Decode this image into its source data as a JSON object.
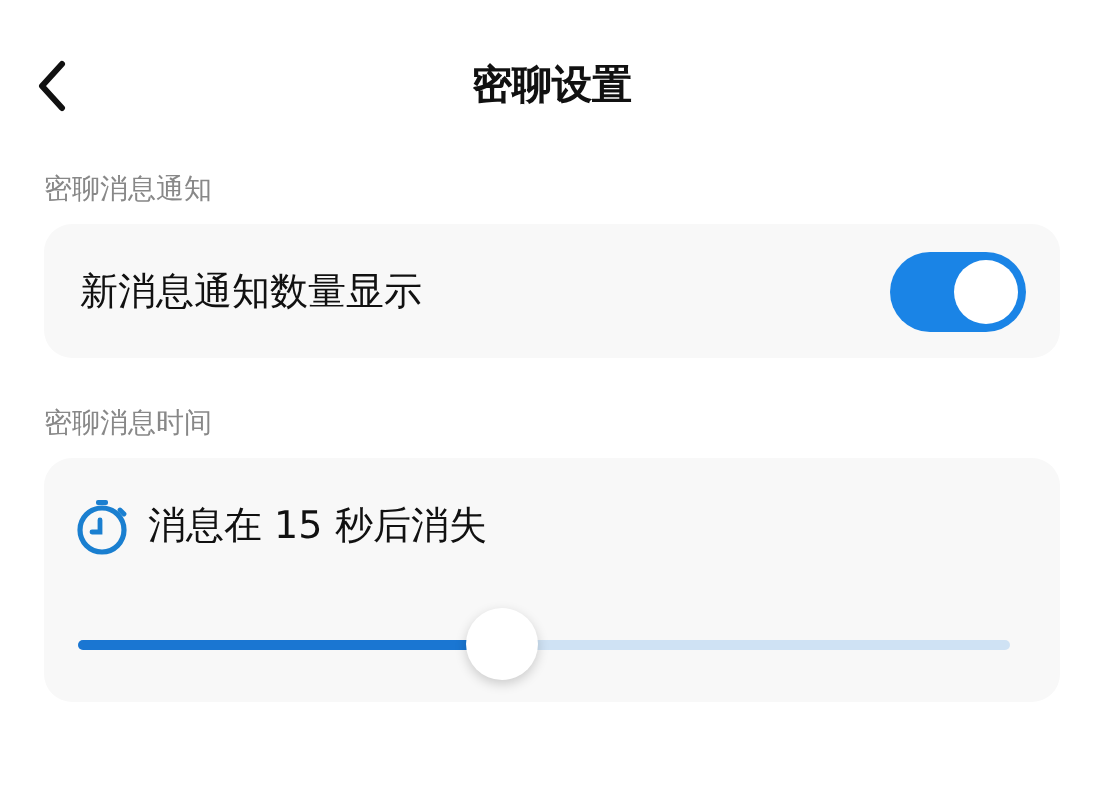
{
  "header": {
    "title": "密聊设置"
  },
  "sections": [
    {
      "label": "密聊消息通知",
      "kind": "toggle",
      "text": "新消息通知数量显示",
      "on": true
    },
    {
      "label": "密聊消息时间",
      "kind": "slider",
      "text": "消息在 15 秒后消失",
      "level": 0.455
    }
  ]
}
